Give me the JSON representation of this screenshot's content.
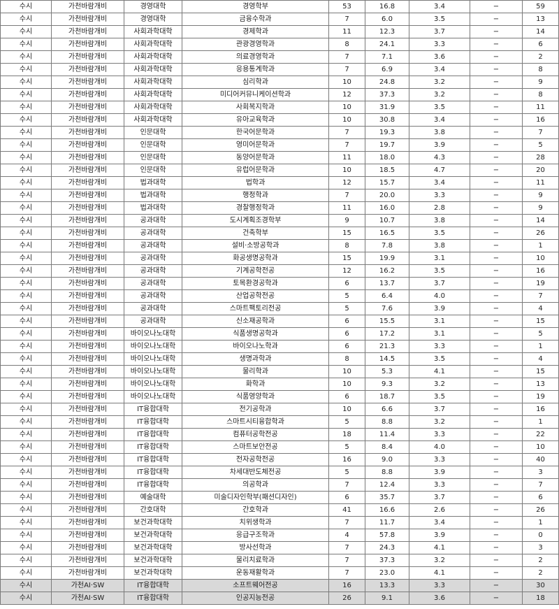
{
  "rows": [
    [
      "수시",
      "가천바람개비",
      "경영대학",
      "경영학부",
      "53",
      "16.8",
      "3.4",
      "−",
      "59"
    ],
    [
      "수시",
      "가천바람개비",
      "경영대학",
      "금융수학과",
      "7",
      "6.0",
      "3.5",
      "−",
      "13"
    ],
    [
      "수시",
      "가천바람개비",
      "사회과학대학",
      "경제학과",
      "11",
      "12.3",
      "3.7",
      "−",
      "14"
    ],
    [
      "수시",
      "가천바람개비",
      "사회과학대학",
      "관광경영학과",
      "8",
      "24.1",
      "3.3",
      "−",
      "6"
    ],
    [
      "수시",
      "가천바람개비",
      "사회과학대학",
      "의료경영학과",
      "7",
      "7.1",
      "3.6",
      "−",
      "2"
    ],
    [
      "수시",
      "가천바람개비",
      "사회과학대학",
      "응용통계학과",
      "7",
      "6.9",
      "3.4",
      "−",
      "8"
    ],
    [
      "수시",
      "가천바람개비",
      "사회과학대학",
      "심리학과",
      "10",
      "24.8",
      "3.2",
      "−",
      "9"
    ],
    [
      "수시",
      "가천바람개비",
      "사회과학대학",
      "미디어커뮤니케이션학과",
      "12",
      "37.3",
      "3.2",
      "−",
      "8"
    ],
    [
      "수시",
      "가천바람개비",
      "사회과학대학",
      "사회복지학과",
      "10",
      "31.9",
      "3.5",
      "−",
      "11"
    ],
    [
      "수시",
      "가천바람개비",
      "사회과학대학",
      "유아교육학과",
      "10",
      "30.8",
      "3.4",
      "−",
      "16"
    ],
    [
      "수시",
      "가천바람개비",
      "인문대학",
      "한국어문학과",
      "7",
      "19.3",
      "3.8",
      "−",
      "7"
    ],
    [
      "수시",
      "가천바람개비",
      "인문대학",
      "영미어문학과",
      "7",
      "19.7",
      "3.9",
      "−",
      "5"
    ],
    [
      "수시",
      "가천바람개비",
      "인문대학",
      "동양어문학과",
      "11",
      "18.0",
      "4.3",
      "−",
      "28"
    ],
    [
      "수시",
      "가천바람개비",
      "인문대학",
      "유럽어문학과",
      "10",
      "18.5",
      "4.7",
      "−",
      "20"
    ],
    [
      "수시",
      "가천바람개비",
      "법과대학",
      "법학과",
      "12",
      "15.7",
      "3.4",
      "−",
      "11"
    ],
    [
      "수시",
      "가천바람개비",
      "법과대학",
      "행정학과",
      "7",
      "20.0",
      "3.3",
      "−",
      "9"
    ],
    [
      "수시",
      "가천바람개비",
      "법과대학",
      "경찰행정학과",
      "11",
      "16.0",
      "2.8",
      "−",
      "9"
    ],
    [
      "수시",
      "가천바람개비",
      "공과대학",
      "도시계획조경학부",
      "9",
      "10.7",
      "3.8",
      "−",
      "14"
    ],
    [
      "수시",
      "가천바람개비",
      "공과대학",
      "건축학부",
      "15",
      "16.5",
      "3.5",
      "−",
      "26"
    ],
    [
      "수시",
      "가천바람개비",
      "공과대학",
      "설비·소방공학과",
      "8",
      "7.8",
      "3.8",
      "−",
      "1"
    ],
    [
      "수시",
      "가천바람개비",
      "공과대학",
      "화공생명공학과",
      "15",
      "19.9",
      "3.1",
      "−",
      "10"
    ],
    [
      "수시",
      "가천바람개비",
      "공과대학",
      "기계공학전공",
      "12",
      "16.2",
      "3.5",
      "−",
      "16"
    ],
    [
      "수시",
      "가천바람개비",
      "공과대학",
      "토목환경공학과",
      "6",
      "13.7",
      "3.7",
      "−",
      "19"
    ],
    [
      "수시",
      "가천바람개비",
      "공과대학",
      "산업공학전공",
      "5",
      "6.4",
      "4.0",
      "−",
      "7"
    ],
    [
      "수시",
      "가천바람개비",
      "공과대학",
      "스마트팩토리전공",
      "5",
      "7.6",
      "3.9",
      "−",
      "4"
    ],
    [
      "수시",
      "가천바람개비",
      "공과대학",
      "신소재공학과",
      "6",
      "15.5",
      "3.1",
      "−",
      "15"
    ],
    [
      "수시",
      "가천바람개비",
      "바이오나노대학",
      "식품생명공학과",
      "6",
      "17.2",
      "3.1",
      "−",
      "5"
    ],
    [
      "수시",
      "가천바람개비",
      "바이오나노대학",
      "바이오나노학과",
      "6",
      "21.3",
      "3.3",
      "−",
      "1"
    ],
    [
      "수시",
      "가천바람개비",
      "바이오나노대학",
      "생명과학과",
      "8",
      "14.5",
      "3.5",
      "−",
      "4"
    ],
    [
      "수시",
      "가천바람개비",
      "바이오나노대학",
      "물리학과",
      "10",
      "5.3",
      "4.1",
      "−",
      "15"
    ],
    [
      "수시",
      "가천바람개비",
      "바이오나노대학",
      "화학과",
      "10",
      "9.3",
      "3.2",
      "−",
      "13"
    ],
    [
      "수시",
      "가천바람개비",
      "바이오나노대학",
      "식품영양학과",
      "6",
      "18.7",
      "3.5",
      "−",
      "19"
    ],
    [
      "수시",
      "가천바람개비",
      "IT융합대학",
      "전기공학과",
      "10",
      "6.6",
      "3.7",
      "−",
      "16"
    ],
    [
      "수시",
      "가천바람개비",
      "IT융합대학",
      "스마트시티융합학과",
      "5",
      "8.8",
      "3.2",
      "−",
      "1"
    ],
    [
      "수시",
      "가천바람개비",
      "IT융합대학",
      "컴퓨터공학전공",
      "18",
      "11.4",
      "3.3",
      "−",
      "22"
    ],
    [
      "수시",
      "가천바람개비",
      "IT융합대학",
      "스마트보안전공",
      "5",
      "8.4",
      "4.0",
      "−",
      "10"
    ],
    [
      "수시",
      "가천바람개비",
      "IT융합대학",
      "전자공학전공",
      "16",
      "9.0",
      "3.3",
      "−",
      "40"
    ],
    [
      "수시",
      "가천바람개비",
      "IT융합대학",
      "차세대반도체전공",
      "5",
      "8.8",
      "3.9",
      "−",
      "3"
    ],
    [
      "수시",
      "가천바람개비",
      "IT융합대학",
      "의공학과",
      "7",
      "12.4",
      "3.3",
      "−",
      "7"
    ],
    [
      "수시",
      "가천바람개비",
      "예술대학",
      "미술디자인학부(패션디자인)",
      "6",
      "35.7",
      "3.7",
      "−",
      "6"
    ],
    [
      "수시",
      "가천바람개비",
      "간호대학",
      "간호학과",
      "41",
      "16.6",
      "2.6",
      "−",
      "26"
    ],
    [
      "수시",
      "가천바람개비",
      "보건과학대학",
      "치위생학과",
      "7",
      "11.7",
      "3.4",
      "−",
      "1"
    ],
    [
      "수시",
      "가천바람개비",
      "보건과학대학",
      "응급구조학과",
      "4",
      "57.8",
      "3.9",
      "−",
      "0"
    ],
    [
      "수시",
      "가천바람개비",
      "보건과학대학",
      "방사선학과",
      "7",
      "24.3",
      "4.1",
      "−",
      "3"
    ],
    [
      "수시",
      "가천바람개비",
      "보건과학대학",
      "물리치료학과",
      "7",
      "37.3",
      "3.2",
      "−",
      "2"
    ],
    [
      "수시",
      "가천바람개비",
      "보건과학대학",
      "운동재활학과",
      "7",
      "23.0",
      "4.1",
      "−",
      "2"
    ],
    [
      "수시",
      "가천AI·SW",
      "IT융합대학",
      "소프트웨어전공",
      "16",
      "13.3",
      "3.3",
      "−",
      "30"
    ],
    [
      "수시",
      "가천AI·SW",
      "IT융합대학",
      "인공지능전공",
      "26",
      "9.1",
      "3.6",
      "−",
      "18"
    ]
  ],
  "shaded_from_row": 46
}
